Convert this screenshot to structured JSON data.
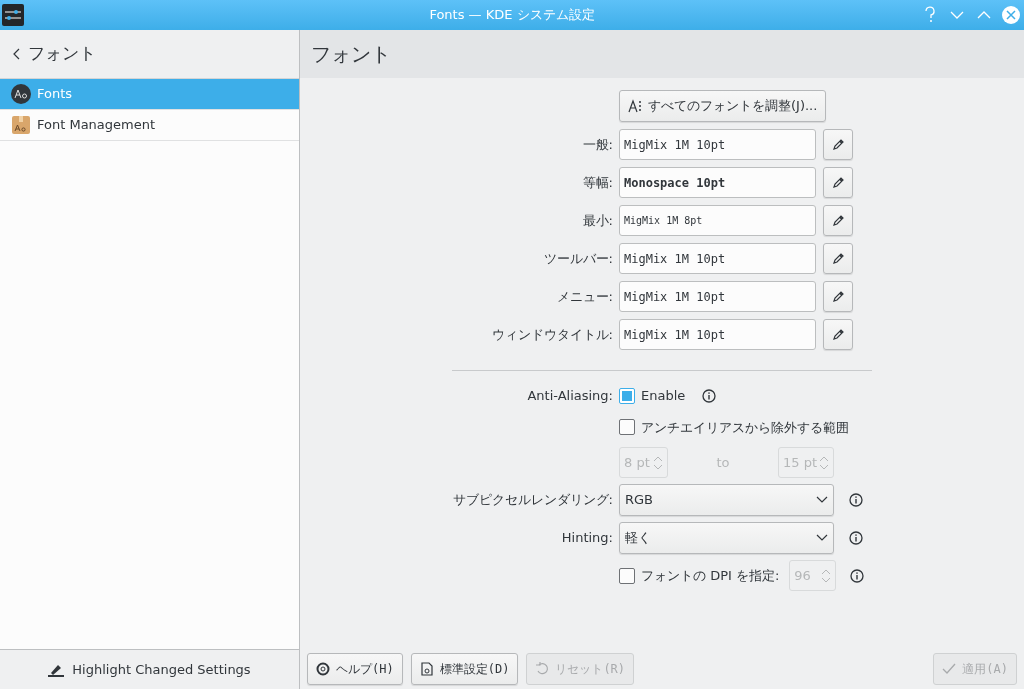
{
  "window": {
    "title": "Fonts — KDE システム設定"
  },
  "sidebar": {
    "header": "フォント",
    "items": [
      {
        "label": "Fonts",
        "selected": true,
        "kind": "fonts"
      },
      {
        "label": "Font Management",
        "selected": false,
        "kind": "management"
      }
    ],
    "footer_button": "Highlight Changed Settings"
  },
  "page_title": "フォント",
  "adjust_button": "すべてのフォントを調整(J)...",
  "font_rows": [
    {
      "label": "一般:",
      "value": "MigMix 1M 10pt",
      "kind": "normal"
    },
    {
      "label": "等幅:",
      "value": "Monospace 10pt",
      "kind": "bold"
    },
    {
      "label": "最小:",
      "value": "MigMix 1M 8pt",
      "kind": "small"
    },
    {
      "label": "ツールバー:",
      "value": "MigMix 1M 10pt",
      "kind": "normal"
    },
    {
      "label": "メニュー:",
      "value": "MigMix 1M 10pt",
      "kind": "normal"
    },
    {
      "label": "ウィンドウタイトル:",
      "value": "MigMix 1M 10pt",
      "kind": "normal"
    }
  ],
  "anti_aliasing": {
    "label": "Anti-Aliasing:",
    "enable_label": "Enable",
    "checked": true
  },
  "exclude": {
    "label": "アンチエイリアスから除外する範囲",
    "checked": false,
    "from": "8 pt",
    "to_label": "to",
    "to": "15 pt"
  },
  "subpixel": {
    "label": "サブピクセルレンダリング:",
    "value": "RGB"
  },
  "hinting": {
    "label": "Hinting:",
    "value": "軽く"
  },
  "dpi": {
    "label": "フォントの DPI を指定:",
    "checked": false,
    "value": "96"
  },
  "buttons": [
    {
      "label": "ヘルプ(H)",
      "kind": "help",
      "disabled": false
    },
    {
      "label": "標準設定(D)",
      "kind": "defaults",
      "disabled": false
    },
    {
      "label": "リセット(R)",
      "kind": "reset",
      "disabled": true
    },
    {
      "label": "適用(A)",
      "kind": "apply",
      "disabled": true
    }
  ]
}
